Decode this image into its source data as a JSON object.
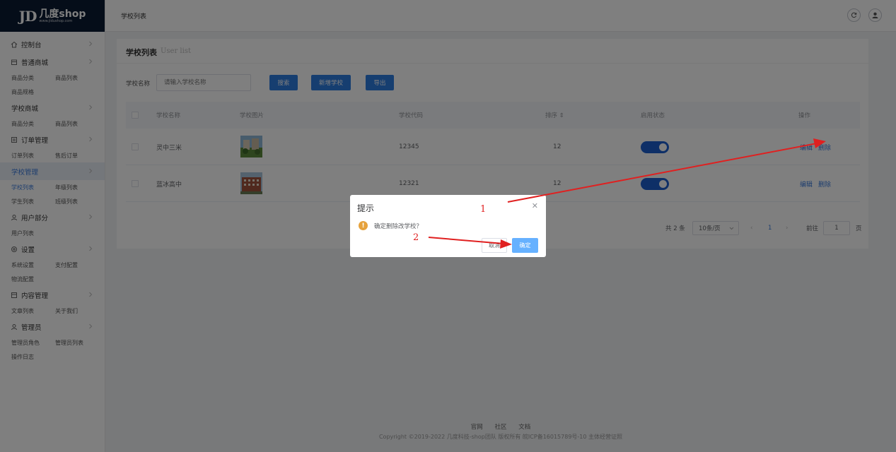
{
  "brand": {
    "mark": "JD",
    "name": "几度shop",
    "url": "www.jidushop.com"
  },
  "header": {
    "title": "学校列表"
  },
  "sidebar": {
    "groups": [
      {
        "label": "控制台",
        "icon": "home-icon",
        "subs": []
      },
      {
        "label": "普通商城",
        "icon": "shop-icon",
        "subs": [
          [
            "商品分类",
            "商品列表"
          ],
          [
            "商品规格"
          ]
        ]
      },
      {
        "label": "学校商城",
        "icon": "",
        "subs": [
          [
            "商品分类",
            "商品列表"
          ]
        ]
      },
      {
        "label": "订单管理",
        "icon": "order-icon",
        "subs": [
          [
            "订单列表",
            "售后订单"
          ]
        ]
      },
      {
        "label": "学校管理",
        "icon": "",
        "active": true,
        "subs": [
          [
            "学校列表",
            "年级列表"
          ],
          [
            "学生列表",
            "班级列表"
          ]
        ]
      },
      {
        "label": "用户部分",
        "icon": "user-icon",
        "subs": [
          [
            "用户列表"
          ]
        ]
      },
      {
        "label": "设置",
        "icon": "settings-icon",
        "subs": [
          [
            "系统设置",
            "支付配置"
          ],
          [
            "物流配置"
          ]
        ]
      },
      {
        "label": "内容管理",
        "icon": "content-icon",
        "subs": [
          [
            "文章列表",
            "关于我们"
          ]
        ]
      },
      {
        "label": "管理员",
        "icon": "admin-icon",
        "subs": [
          [
            "管理员角色",
            "管理员列表"
          ],
          [
            "操作日志"
          ]
        ]
      }
    ]
  },
  "page": {
    "title": "学校列表",
    "subtitle": "User list",
    "filter_label": "学校名称",
    "search_placeholder": "请输入学校名称",
    "search_btn": "搜索",
    "add_btn": "新增学校",
    "export_btn": "导出"
  },
  "table": {
    "columns": [
      "学校名称",
      "学校图片",
      "学校代码",
      "排序 ⇕",
      "启用状态",
      "操作"
    ],
    "rows": [
      {
        "name": "灵中三米",
        "code": "12345",
        "sort": "12",
        "enabled": true,
        "edit": "编辑",
        "delete": "删除"
      },
      {
        "name": "蓝冰高中",
        "code": "12321",
        "sort": "12",
        "enabled": true,
        "edit": "编辑",
        "delete": "删除"
      }
    ]
  },
  "pagination": {
    "total": "共 2 条",
    "page_size": "10条/页",
    "current": "1",
    "goto_label": "前往",
    "goto_value": "1",
    "page_unit": "页"
  },
  "footer": {
    "links": [
      "官网",
      "社区",
      "文档"
    ],
    "copyright": "Copyright ©2019-2022 几度科技-shop团队 版权所有 皖ICP备16015789号-10 主体经营证照"
  },
  "dialog": {
    "title": "提示",
    "message": "确定删除改学校？",
    "cancel": "取消",
    "confirm": "确定"
  },
  "annotations": [
    "1",
    "2"
  ],
  "colors": {
    "primary": "#2d7ce0",
    "sidebar_dark": "#0b1a33",
    "warning": "#e6a23c",
    "arrow": "#e02020"
  }
}
